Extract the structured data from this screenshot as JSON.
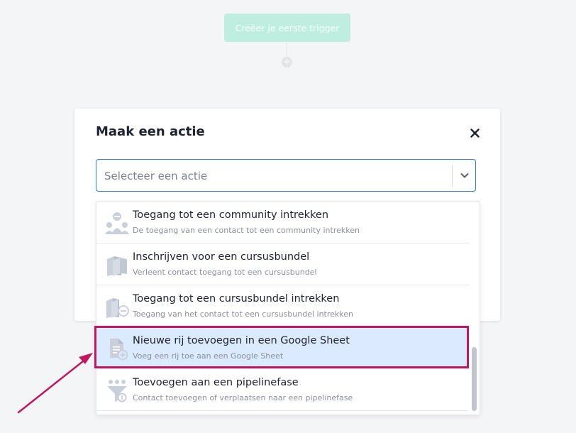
{
  "trigger": {
    "label": "Creëer je eerste trigger"
  },
  "add_node": {
    "glyph": "+"
  },
  "modal": {
    "title": "Maak een actie",
    "close_icon": "close-icon",
    "select": {
      "placeholder": "Selecteer een actie",
      "chevron_icon": "chevron-down-icon"
    }
  },
  "dropdown": {
    "options": [
      {
        "title": "Toegang tot een community intrekken",
        "description": "De toegang van een contact tot een community intrekken",
        "icon": "community-revoke-icon"
      },
      {
        "title": "Inschrijven voor een cursusbundel",
        "description": "Verleent contact toegang tot een cursusbundel",
        "icon": "course-bundle-icon"
      },
      {
        "title": "Toegang tot een cursusbundel intrekken",
        "description": "Toegang van het contact tot een cursusbundel intrekken",
        "icon": "course-bundle-revoke-icon"
      },
      {
        "title": "Nieuwe rij toevoegen in een Google Sheet",
        "description": "Voeg een rij toe aan een Google Sheet",
        "icon": "sheet-add-row-icon",
        "selected": true
      },
      {
        "title": "Toevoegen aan een pipelinefase",
        "description": "Contact toevoegen of verplaatsen naar een pipelinefase",
        "icon": "pipeline-icon"
      }
    ]
  },
  "colors": {
    "accent_blue": "#2f7fe0",
    "trigger_green": "#bfeee0",
    "selected_bg": "#dbeafe",
    "annotation_magenta": "#c0185e",
    "icon_gray": "#c9cfdb"
  }
}
